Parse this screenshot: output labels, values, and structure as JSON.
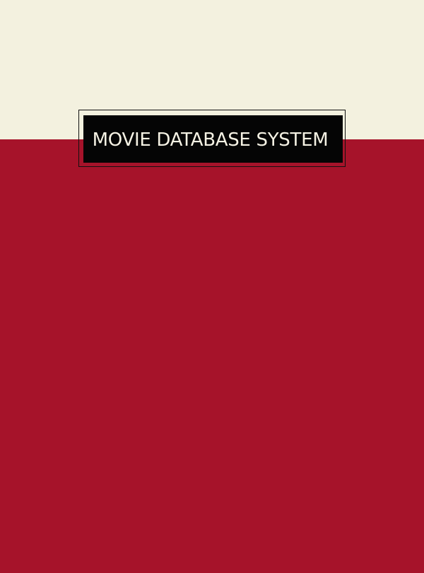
{
  "header": {
    "title": "MOVIE DATABASE SYSTEM"
  },
  "colors": {
    "top_background": "#f3f1df",
    "main_background": "#a6132a",
    "title_box": "#050505",
    "title_text": "#f5f2e4",
    "frame_border": "#111111"
  }
}
